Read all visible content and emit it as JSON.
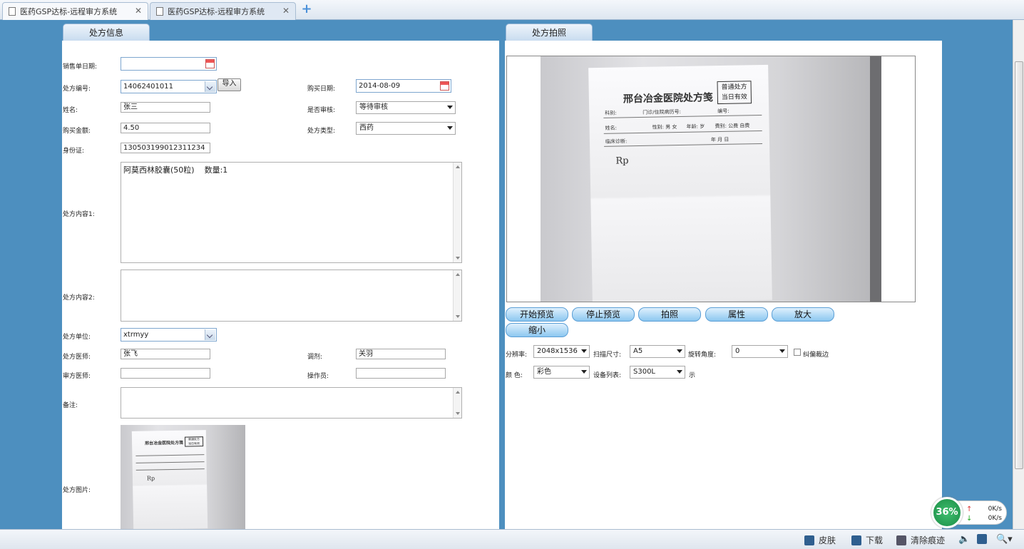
{
  "tabs": [
    {
      "title": "医药GSP达标-远程审方系统"
    },
    {
      "title": "医药GSP达标-远程审方系统"
    }
  ],
  "left_panel": {
    "tab_label": "处方信息",
    "fields": {
      "sale_date_label": "销售单日期:",
      "sale_date_value": "",
      "rx_no_label": "处方编号:",
      "rx_no_value": "14062401011",
      "import_label": "导入",
      "buy_date_label": "购买日期:",
      "buy_date_value": "2014-08-09",
      "name_label": "姓名:",
      "name_value": "张三",
      "review_label": "是否审核:",
      "review_value": "等待审核",
      "amount_label": "购买金额:",
      "amount_value": "4.50",
      "rx_type_label": "处方类型:",
      "rx_type_value": "西药",
      "id_label": "身份证:",
      "id_value": "130503199012311234",
      "content1_label": "处方内容1:",
      "content1_value": "阿莫西林胶囊(50粒)    数量:1",
      "content2_label": "处方内容2:",
      "content2_value": "",
      "unit_label": "处方单位:",
      "unit_value": "xtrmyy",
      "doctor_label": "处方医师:",
      "doctor_value": "张飞",
      "dispense_label": "调剂:",
      "dispense_value": "关羽",
      "reviewer_label": "审方医师:",
      "reviewer_value": "",
      "operator_label": "操作员:",
      "operator_value": "",
      "remark_label": "备注:",
      "remark_value": "",
      "image_label": "处方图片:"
    }
  },
  "right_panel": {
    "tab_label": "处方拍照",
    "buttons": {
      "start": "开始预览",
      "stop": "停止预览",
      "shoot": "拍照",
      "props": "属性",
      "zoom_in": "放大",
      "zoom_out": "缩小"
    },
    "settings": {
      "res_label": "分辨率:",
      "res_value": "2048x1536",
      "size_label": "扫描尺寸:",
      "size_value": "A5",
      "rot_label": "旋转角度:",
      "rot_value": "0",
      "deskew_label": "纠偏裁边",
      "color_label": "颜  色:",
      "color_value": "彩色",
      "dev_label": "设备列表:",
      "dev_value": "S300L",
      "show_label": "示"
    }
  },
  "prescription_paper": {
    "title": "邢台冶金医院处方笺",
    "stamp_line1": "普通处方",
    "stamp_line2": "当日有效",
    "row1a": "科别:",
    "row1b": "门诊/住院病历号:",
    "row1c": "编号:",
    "row2a": "姓名:",
    "row2b": "性别: 男 女",
    "row2c": "年龄:   岁",
    "row2d": "费别: 公费 自费",
    "row3a": "临床诊断:",
    "row3b": "年    月    日",
    "rp": "Rp"
  },
  "statusbar": {
    "skin": "皮肤",
    "download": "下载",
    "clear": "清除痕迹"
  },
  "speed_widget": {
    "percent": "36%",
    "up": "0K/s",
    "down": "0K/s"
  }
}
